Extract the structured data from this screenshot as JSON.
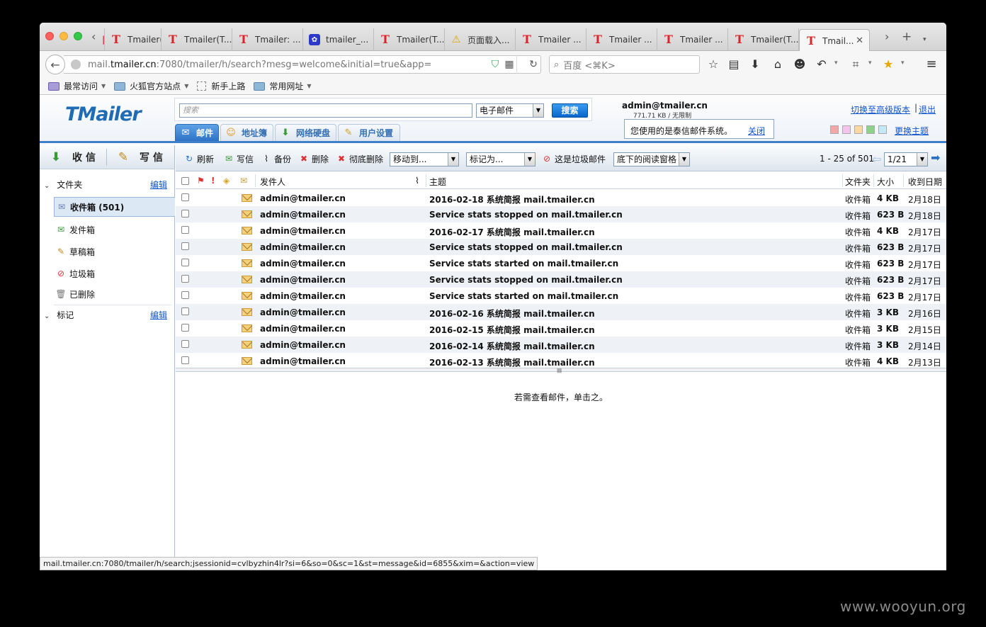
{
  "browser": {
    "tabs": [
      {
        "label": "",
        "icon": "tmailer-t-icon"
      },
      {
        "label": "Tmailer(T...",
        "icon": "tmailer-t-icon"
      },
      {
        "label": "Tmailer(T...",
        "icon": "tmailer-t-icon"
      },
      {
        "label": "Tmailer: ...",
        "icon": "tmailer-t-icon"
      },
      {
        "label": "tmailer_...",
        "icon": "baidu-paw-icon"
      },
      {
        "label": "Tmailer(T...",
        "icon": "tmailer-t-icon"
      },
      {
        "label": "页面载入...",
        "icon": "warning-icon"
      },
      {
        "label": "Tmailer ...",
        "icon": "tmailer-t-icon"
      },
      {
        "label": "Tmailer ...",
        "icon": "tmailer-t-icon"
      },
      {
        "label": "Tmailer ...",
        "icon": "tmailer-t-icon"
      },
      {
        "label": "Tmailer(T...",
        "icon": "tmailer-t-icon"
      },
      {
        "label": "Tmail...",
        "icon": "tmailer-t-icon",
        "active": true
      }
    ],
    "url": {
      "prefix": "mail.",
      "host": "tmailer.cn",
      "rest": ":7080/tmailer/h/search?mesg=welcome&initial=true&app="
    },
    "search_placeholder": "百度 <⌘K>",
    "bookmarks": [
      "最常访问",
      "火狐官方站点",
      "新手上路",
      "常用网址"
    ],
    "status_url": "mail.tmailer.cn:7080/tmailer/h/search;jsessionid=cvlbyzhin4lr?si=6&so=0&sc=1&st=message&id=6855&xim=&action=view"
  },
  "app": {
    "logo": "TMailer",
    "search": {
      "placeholder": "搜索",
      "scope": "电子邮件",
      "button": "搜索"
    },
    "main_tabs": [
      "邮件",
      "地址簿",
      "网络硬盘",
      "用户设置"
    ],
    "account": "admin@tmailer.cn",
    "quota": "771.71 KB / 无限制",
    "notice": {
      "text": "您使用的是泰信邮件系统。",
      "close": "关闭"
    },
    "advanced_link": "切换至高级版本",
    "separator": "|",
    "logout": "退出",
    "theme_link": "更换主题",
    "theme_swatches": [
      "#f3a7a7",
      "#f4c3ee",
      "#fbd8a0",
      "#8ed18a",
      "#c5e8f8"
    ]
  },
  "sidebar": {
    "receive": "收信",
    "compose": "写信",
    "folders_header": "文件夹",
    "edit": "编辑",
    "folders": [
      "收件箱 (501)",
      "发件箱",
      "草稿箱",
      "垃圾箱",
      "已删除"
    ],
    "tags_header": "标记",
    "tags_edit": "编辑"
  },
  "toolbar": {
    "refresh": "刷新",
    "compose": "写信",
    "backup": "备份",
    "delete": "删除",
    "delete_perm": "彻底删除",
    "move_to": "移动到...",
    "mark_as": "标记为...",
    "spam": "这是垃圾邮件",
    "reading_pane": "底下的阅读窗格",
    "range": "1 - 25 of 501",
    "page": "1/21"
  },
  "list": {
    "headers": {
      "sender": "发件人",
      "subject": "主题",
      "folder": "文件夹",
      "size": "大小",
      "date": "收到日期"
    },
    "rows": [
      {
        "sender": "admin@tmailer.cn",
        "subject": "2016-02-18 系统简报 mail.tmailer.cn",
        "folder": "收件箱",
        "size": "4 KB",
        "date": "2月18日"
      },
      {
        "sender": "admin@tmailer.cn",
        "subject": "Service stats stopped on mail.tmailer.cn",
        "folder": "收件箱",
        "size": "623 B",
        "date": "2月18日"
      },
      {
        "sender": "admin@tmailer.cn",
        "subject": "2016-02-17 系统简报 mail.tmailer.cn",
        "folder": "收件箱",
        "size": "4 KB",
        "date": "2月17日"
      },
      {
        "sender": "admin@tmailer.cn",
        "subject": "Service stats stopped on mail.tmailer.cn",
        "folder": "收件箱",
        "size": "623 B",
        "date": "2月17日"
      },
      {
        "sender": "admin@tmailer.cn",
        "subject": "Service stats started on mail.tmailer.cn",
        "folder": "收件箱",
        "size": "623 B",
        "date": "2月17日"
      },
      {
        "sender": "admin@tmailer.cn",
        "subject": "Service stats stopped on mail.tmailer.cn",
        "folder": "收件箱",
        "size": "623 B",
        "date": "2月17日"
      },
      {
        "sender": "admin@tmailer.cn",
        "subject": "Service stats started on mail.tmailer.cn",
        "folder": "收件箱",
        "size": "623 B",
        "date": "2月17日"
      },
      {
        "sender": "admin@tmailer.cn",
        "subject": "2016-02-16 系统简报 mail.tmailer.cn",
        "folder": "收件箱",
        "size": "3 KB",
        "date": "2月16日"
      },
      {
        "sender": "admin@tmailer.cn",
        "subject": "2016-02-15 系统简报 mail.tmailer.cn",
        "folder": "收件箱",
        "size": "3 KB",
        "date": "2月15日"
      },
      {
        "sender": "admin@tmailer.cn",
        "subject": "2016-02-14 系统简报 mail.tmailer.cn",
        "folder": "收件箱",
        "size": "3 KB",
        "date": "2月14日"
      },
      {
        "sender": "admin@tmailer.cn",
        "subject": "2016-02-13 系统简报 mail.tmailer.cn",
        "folder": "收件箱",
        "size": "4 KB",
        "date": "2月13日"
      }
    ],
    "hint": "若需查看邮件，单击之。"
  },
  "watermark": "www.wooyun.org"
}
